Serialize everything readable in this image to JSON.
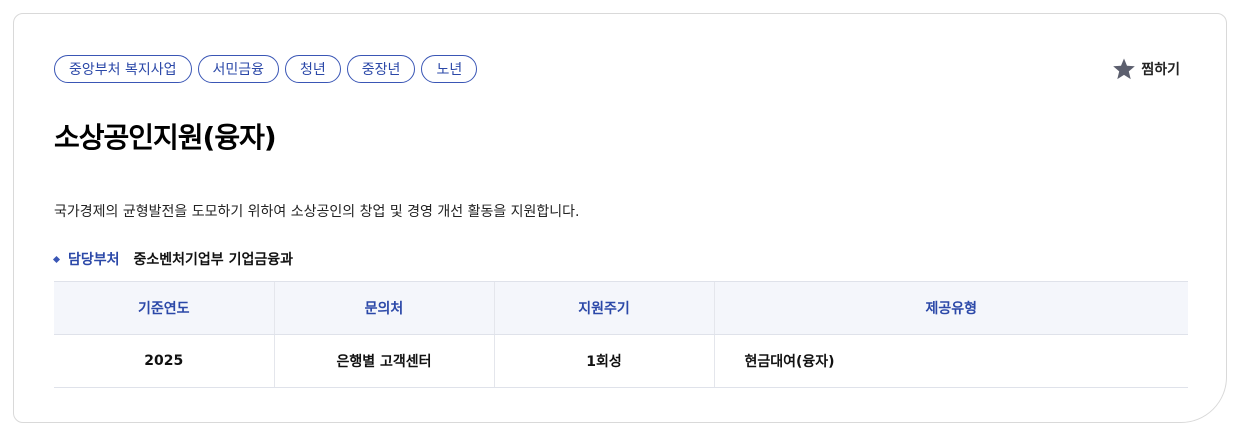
{
  "tags": [
    "중앙부처 복지사업",
    "서민금융",
    "청년",
    "중장년",
    "노년"
  ],
  "favorite": {
    "label": "찜하기",
    "icon": "star-icon",
    "color": "#5c5f6e"
  },
  "title": "소상공인지원(융자)",
  "description": "국가경제의 균형발전을 도모하기 위하여 소상공인의 창업 및 경영 개선 활동을 지원합니다.",
  "department": {
    "label": "담당부처",
    "value": "중소벤처기업부 기업금융과"
  },
  "table": {
    "headers": [
      "기준연도",
      "문의처",
      "지원주기",
      "제공유형"
    ],
    "rows": [
      [
        "2025",
        "은행별 고객센터",
        "1회성",
        "현금대여(융자)"
      ]
    ]
  },
  "colors": {
    "accent": "#2b48a8",
    "header_bg": "#f4f6fb"
  }
}
